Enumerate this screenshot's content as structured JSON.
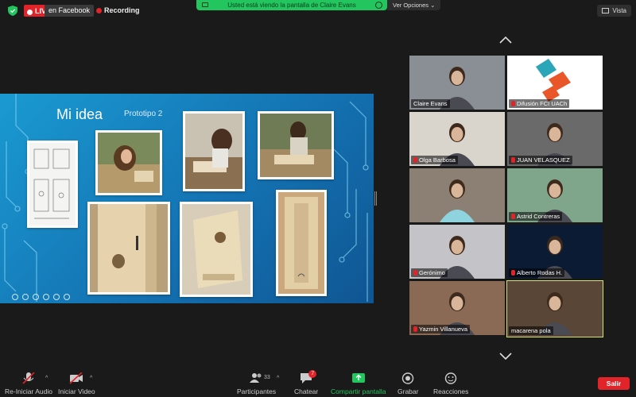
{
  "topbar": {
    "live_label": "LIVE",
    "live_platform": "en Facebook",
    "recording_label": "Recording",
    "share_notice": "Usted está viendo la pantalla de Claire Evans",
    "view_options_label": "Ver Opciones",
    "view_label": "Vista"
  },
  "slide": {
    "title": "Mi idea",
    "subtitle": "Prototipo 2",
    "background_color": "#1582c2"
  },
  "gallery": {
    "participants": [
      {
        "name": "Claire Evans",
        "muted": false,
        "bg": "#8a8f95"
      },
      {
        "name": "Difusión FCI UACh",
        "muted": true,
        "bg": "#ffffff"
      },
      {
        "name": "Olga Barbosa",
        "muted": true,
        "bg": "#d9d4cc"
      },
      {
        "name": "JUAN VELASQUEZ",
        "muted": true,
        "bg": "#6b6a6a"
      },
      {
        "name": "",
        "muted": false,
        "bg": "#8c8075"
      },
      {
        "name": "Astrid Contreras",
        "muted": true,
        "bg": "#7fa68a"
      },
      {
        "name": "Gerónimo",
        "muted": true,
        "bg": "#c4c3c7"
      },
      {
        "name": "Alberto Rodas H.",
        "muted": true,
        "bg": "#0b1b33"
      },
      {
        "name": "Yazmin Villanueva",
        "muted": true,
        "bg": "#8a6a55"
      },
      {
        "name": "macarena pola",
        "muted": false,
        "bg": "#5a4636"
      }
    ]
  },
  "toolbar": {
    "audio_label": "Re-Iniciar Audio",
    "video_label": "Iniciar Video",
    "participants_label": "Participantes",
    "participants_count": "33",
    "chat_label": "Chatear",
    "chat_badge": "7",
    "share_label": "Compartir pantalla",
    "record_label": "Grabar",
    "reactions_label": "Reacciones",
    "leave_label": "Salir"
  },
  "colors": {
    "live_red": "#e0242a",
    "share_green": "#22c55e",
    "active_speaker": "#d6e36a"
  }
}
